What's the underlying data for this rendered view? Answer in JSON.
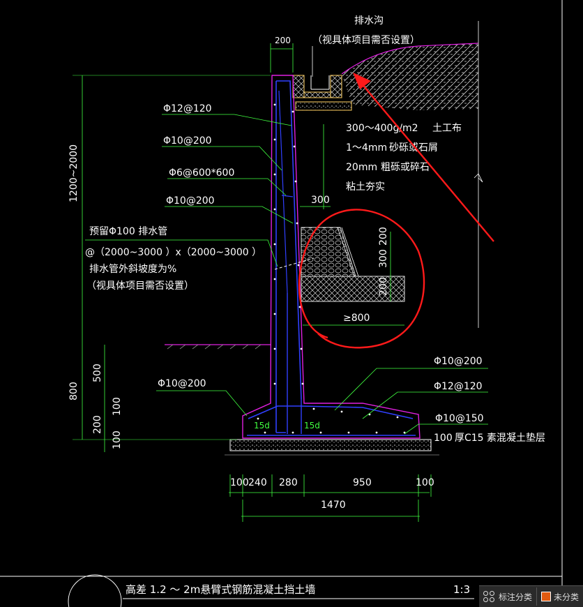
{
  "drawing": {
    "drain_ditch": {
      "title": "排水沟",
      "note": "（视具体项目需否设置）"
    },
    "dim_top_200": "200",
    "rebar_labels": [
      "Φ12@120",
      "Φ10@200",
      "Φ6@600*600",
      "Φ10@200"
    ],
    "filter_layers": {
      "geotextile_spec": "300～400g/m2",
      "geotextile_name": "土工布",
      "sand_spec": "1～4mm",
      "sand_name": "砂砾或石屑",
      "gravel_spec": "20mm",
      "gravel_name": "粗砾或碎石",
      "clay": "粘土夯实"
    },
    "dim_300_label": "300",
    "drain_pipe": {
      "line1": "预留Φ100  排水管",
      "line2": "@（2000~3000     ）x（2000~3000     ）",
      "line3": "排水管外斜坡度为%",
      "line4": "（视具体项目需否设置）"
    },
    "filter_dims": {
      "a": "200",
      "b": "300",
      "c": "200",
      "width": "≥800"
    },
    "height_range": "1200~2000",
    "left_dims": {
      "total": "800",
      "upper": "500",
      "mid": "100",
      "lower": "200",
      "base": "100"
    },
    "base_rebar": [
      "Φ10@200",
      "Φ12@120",
      "Φ10@150"
    ],
    "left_base_rebar": "Φ10@200",
    "anchor_labels": [
      "15d",
      "15d"
    ],
    "cushion": {
      "thickness": "100",
      "desc": "厚C15  素混凝土垫层"
    },
    "bottom_dims": [
      "100",
      "240",
      "280",
      "950",
      "100"
    ],
    "total_width": "1470",
    "title": {
      "text": "高差    1.2   ～  2m悬臂式钢筋混凝土挡土墙",
      "scale": "1:3"
    }
  },
  "toolbar": {
    "classify_label": "标注分类",
    "unclassified_label": "未分类"
  },
  "colors": {
    "background": "#000000",
    "wall_outline": "#e020e0",
    "rebar": "#3040ff",
    "dimension": "#40ff40",
    "annotation_red": "#ff1a1a",
    "drain_yellow": "#ffd060"
  }
}
